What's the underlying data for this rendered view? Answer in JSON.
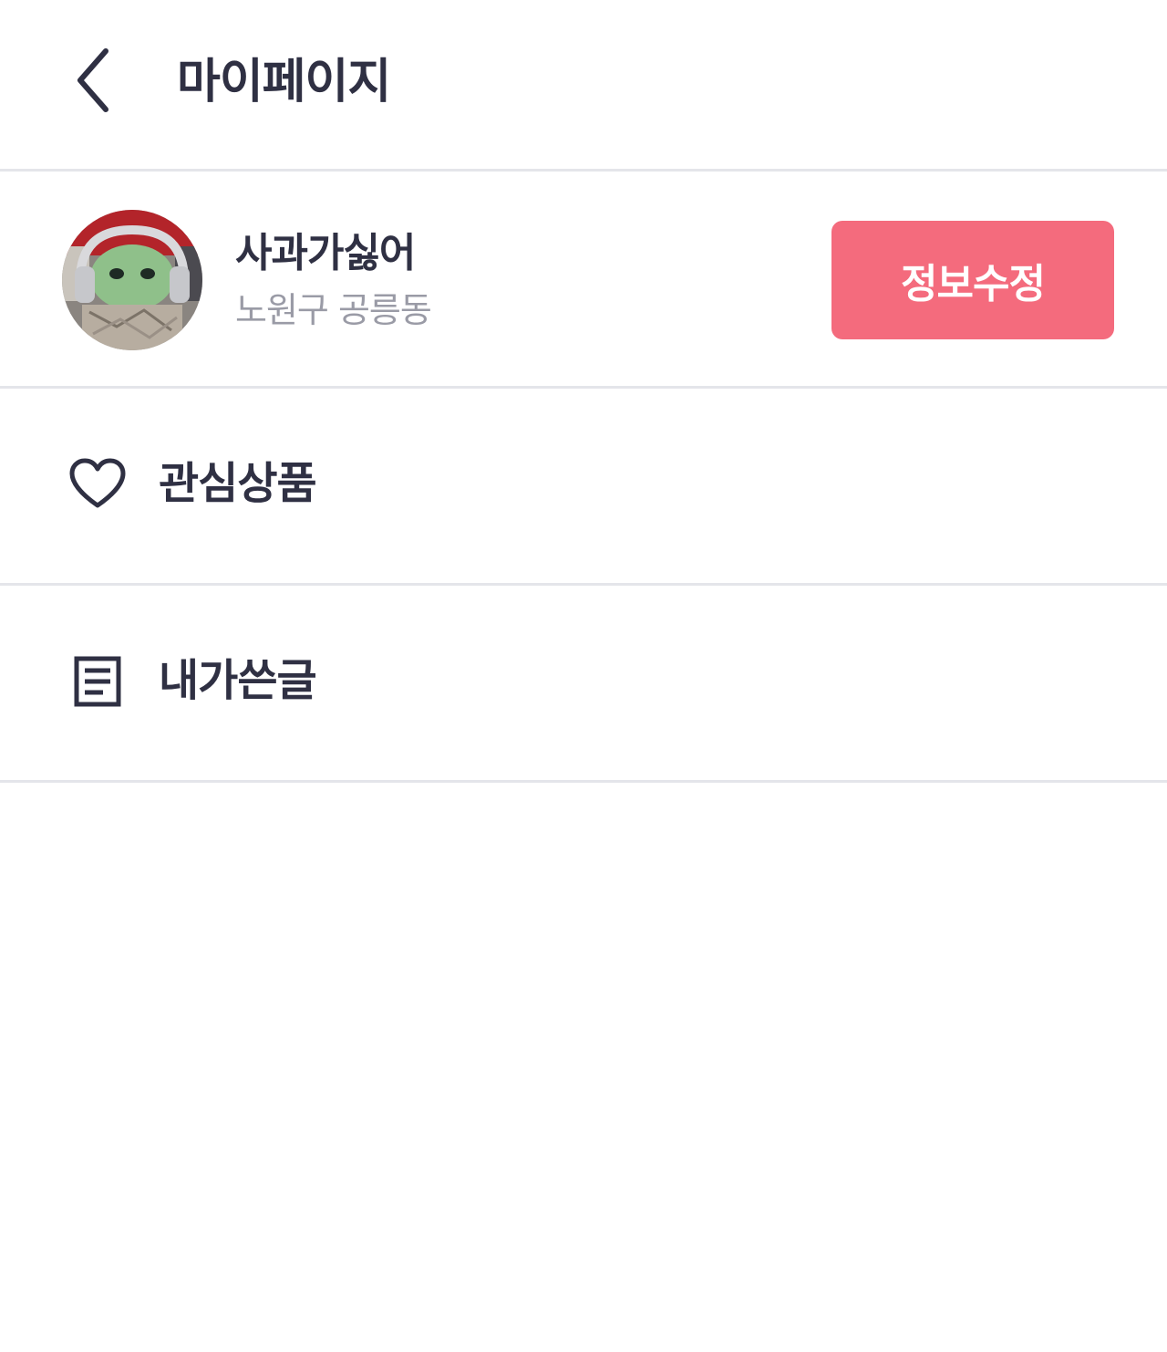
{
  "header": {
    "title": "마이페이지",
    "back_icon": "chevron-left-icon"
  },
  "profile": {
    "nickname": "사과가싫어",
    "location": "노원구 공릉동",
    "edit_label": "정보수정",
    "edit_color": "#f46b7d"
  },
  "menu": {
    "items": [
      {
        "label": "관심상품",
        "icon": "heart-icon"
      },
      {
        "label": "내가쓴글",
        "icon": "document-icon"
      }
    ]
  }
}
